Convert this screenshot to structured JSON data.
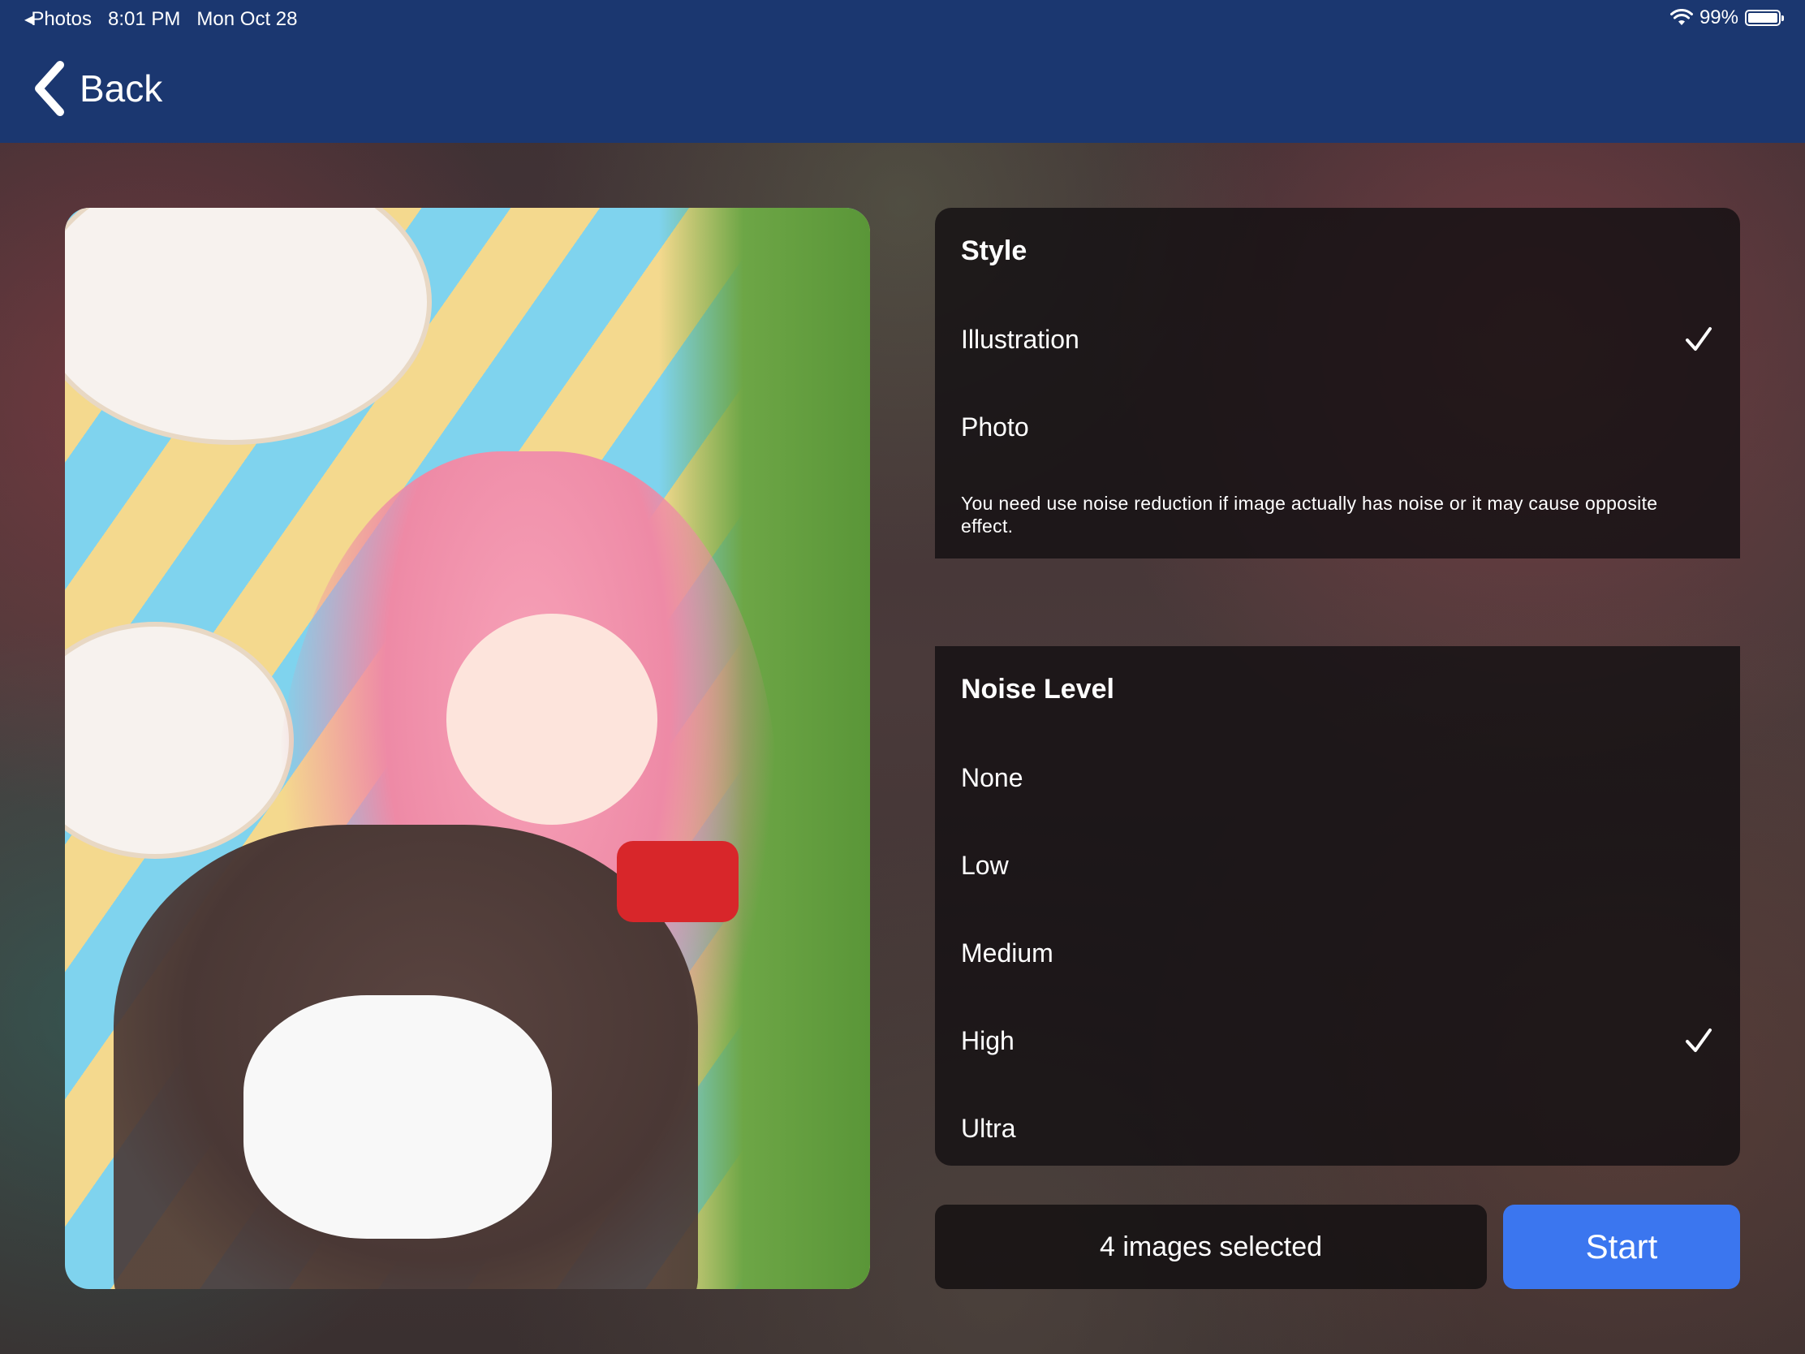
{
  "status_bar": {
    "back_app": "Photos",
    "time": "8:01 PM",
    "date": "Mon Oct 28",
    "battery": "99%"
  },
  "nav": {
    "back_label": "Back"
  },
  "style_section": {
    "title": "Style",
    "options": [
      {
        "label": "Illustration",
        "selected": true
      },
      {
        "label": "Photo",
        "selected": false
      }
    ],
    "note": "You need use noise reduction if image actually has noise or it may cause opposite effect."
  },
  "noise_section": {
    "title": "Noise Level",
    "options": [
      {
        "label": "None",
        "selected": false
      },
      {
        "label": "Low",
        "selected": false
      },
      {
        "label": "Medium",
        "selected": false
      },
      {
        "label": "High",
        "selected": true
      },
      {
        "label": "Ultra",
        "selected": false
      }
    ]
  },
  "footer": {
    "selection_text": "4 images selected",
    "start_label": "Start"
  },
  "colors": {
    "nav_bar": "#1b3770",
    "start_button": "#3b76ef"
  },
  "icons": {
    "back": "chevron-left-icon",
    "check": "checkmark-icon",
    "wifi": "wifi-icon",
    "battery": "battery-icon"
  }
}
